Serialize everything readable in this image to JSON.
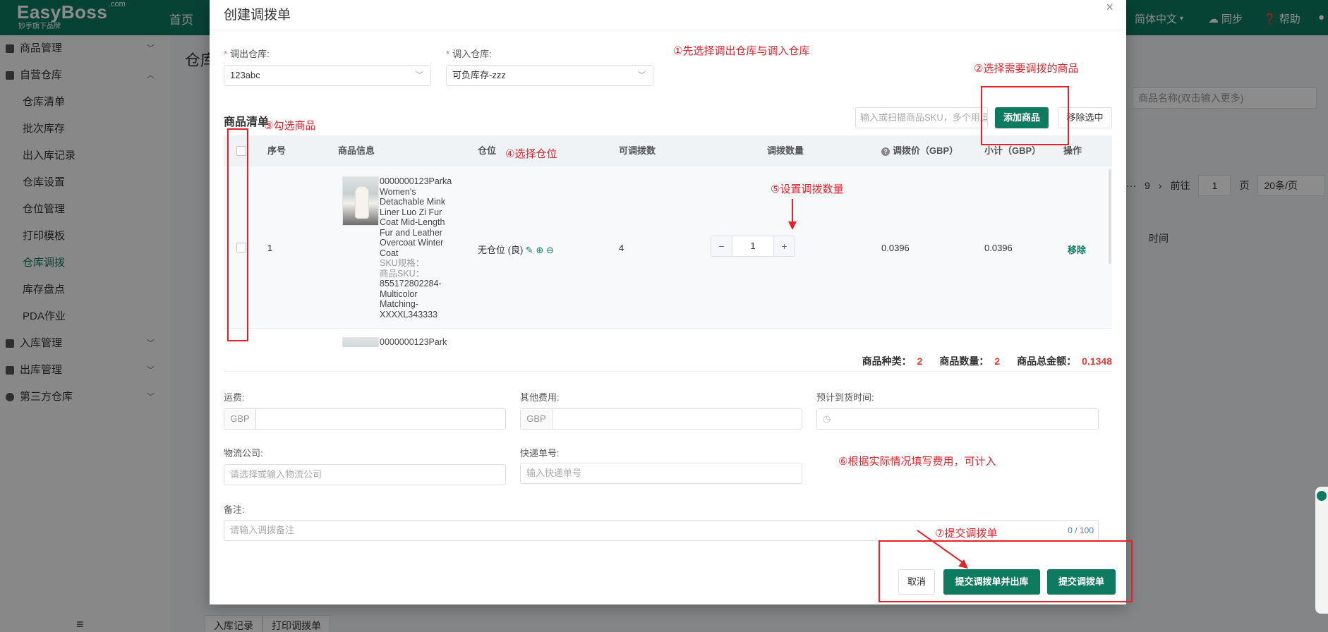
{
  "app": {
    "logo_name": "EasyBoss",
    "logo_com": ".com",
    "logo_sub": "妙手旗下品牌",
    "nav_home": "首页",
    "language": "简体中文",
    "sync": "同步",
    "help": "帮助",
    "page_title": "仓库",
    "right_search_placeholder": "商品名称(双击输入更多)",
    "pager": {
      "last_page": "9",
      "goto_label": "前往",
      "goto_value": "1",
      "page_unit": "页",
      "page_size": "20条/页"
    },
    "bg_time_col": "时间",
    "bottom_tabs": [
      "入库记录",
      "打印调拨单"
    ],
    "menu_icon": "≡"
  },
  "sidebar": {
    "groups": [
      {
        "label": "商品管理",
        "expanded": false
      },
      {
        "label": "自营仓库",
        "expanded": true,
        "items": [
          "仓库清单",
          "批次库存",
          "出入库记录",
          "仓库设置",
          "仓位管理",
          "打印模板",
          "仓库调拨",
          "库存盘点",
          "PDA作业"
        ]
      },
      {
        "label": "入库管理",
        "expanded": false
      },
      {
        "label": "出库管理",
        "expanded": false
      },
      {
        "label": "第三方仓库",
        "expanded": false
      }
    ],
    "active_item": "仓库调拨"
  },
  "modal": {
    "title": "创建调拨单",
    "close": "×",
    "from_label": "调出仓库:",
    "from_value": "123abc",
    "to_label": "调入仓库:",
    "to_value": "可负库存-zzz",
    "list_title": "商品清单",
    "sku_placeholder": "输入或扫描商品SKU，多个用逗号隔开",
    "add_button": "添加商品",
    "remove_selected_button": "移除选中",
    "columns": [
      "序号",
      "商品信息",
      "仓位",
      "可调拨数",
      "调拨数量",
      "调拨价（GBP）",
      "小计（GBP）",
      "操作"
    ],
    "rows": [
      {
        "index": "1",
        "title": "0000000123Parka Women's Detachable Mink Liner Luo Zi Fur Coat Mid-Length Fur and Leather Overcoat Winter Coat",
        "sku_spec_label": "SKU规格：",
        "sku_label": "商品SKU：",
        "sku": "855172802284-Multicolor Matching-XXXXL343333",
        "location": "无仓位 (良)",
        "available": "4",
        "quantity": "1",
        "price": "0.0396",
        "subtotal": "0.0396",
        "action": "移除"
      },
      {
        "title": "0000000123Park"
      }
    ],
    "summary": {
      "kinds_label": "商品种类：",
      "kinds": "2",
      "qty_label": "商品数量：",
      "qty": "2",
      "total_label": "商品总金额：",
      "total": "0.1348"
    },
    "freight_label": "运费:",
    "other_fee_label": "其他费用:",
    "eta_label": "预计到货时间:",
    "currency": "GBP",
    "carrier_label": "物流公司:",
    "carrier_placeholder": "请选择或输入物流公司",
    "tracking_label": "快递单号:",
    "tracking_placeholder": "输入快递单号",
    "remark_label": "备注:",
    "remark_placeholder": "请输入调拨备注",
    "remark_counter": "0 / 100",
    "cancel_button": "取消",
    "submit_out_button": "提交调拨单并出库",
    "submit_button": "提交调拨单"
  },
  "annotations": {
    "a1": "①先选择调出仓库与调入仓库",
    "a2": "②选择需要调拨的商品",
    "a3": "③勾选商品",
    "a4": "④选择仓位",
    "a5": "⑤设置调拨数量",
    "a6": "⑥根据实际情况填写费用，可计入",
    "a7": "⑦提交调拨单"
  },
  "colors": {
    "brand": "#0e7a5f",
    "annotation": "#e8202a",
    "danger": "#e53935"
  }
}
